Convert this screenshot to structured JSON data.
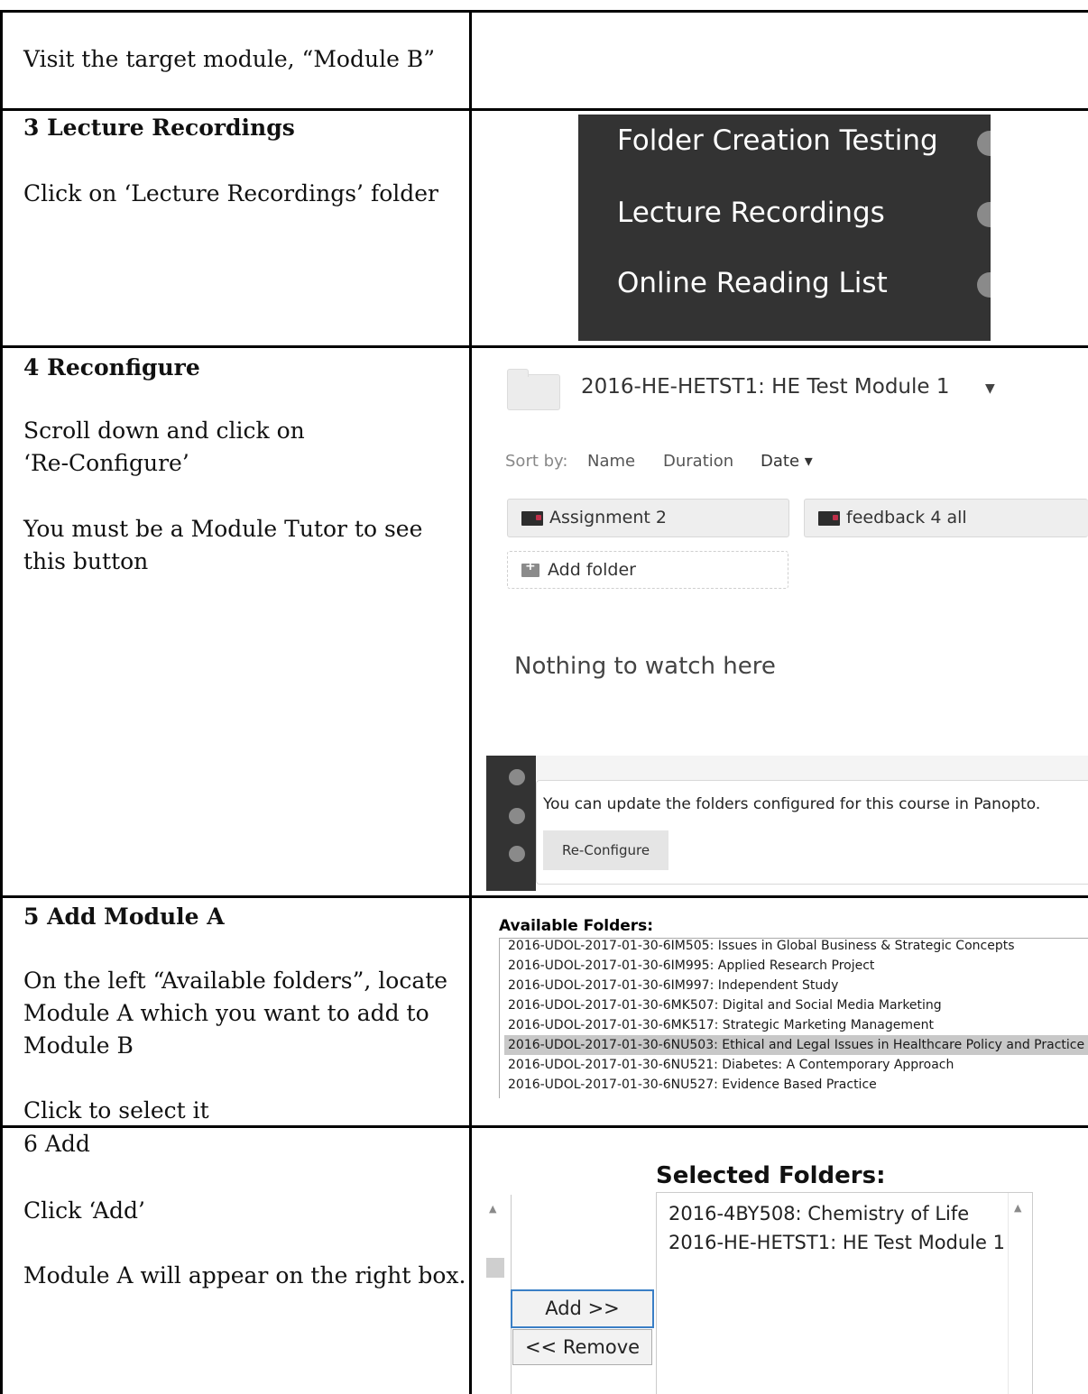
{
  "rows": {
    "r2": {
      "text": "Visit the target module, “Module B”"
    },
    "r3": {
      "heading": "3 Lecture Recordings",
      "text": "Click on ‘Lecture Recordings’ folder"
    },
    "r4": {
      "heading": "4 Reconfigure",
      "text1a": "Scroll down and click on",
      "text1b": "‘Re-Configure’",
      "text2a": "You must be a Module Tutor to see",
      "text2b": "this button"
    },
    "r5": {
      "heading": "5 Add Module A",
      "text1a": "On the left “Available folders”, locate",
      "text1b": "Module A which you want to add to",
      "text1c": "Module B",
      "text2": "Click to select it"
    },
    "r6": {
      "heading": "6  Add",
      "text1": "Click ‘Add’",
      "text2": "Module A will appear on the right box."
    }
  },
  "menu": {
    "items": [
      "Folder Creation Testing",
      "Lecture Recordings",
      "Online Reading List"
    ]
  },
  "panopto": {
    "title": "2016-HE-HETST1: HE Test Module 1",
    "sort_label": "Sort by:",
    "sort_name": "Name",
    "sort_duration": "Duration",
    "sort_date": "Date ▾",
    "folders": [
      "Assignment 2",
      "feedback 4 all"
    ],
    "add_folder": "Add folder",
    "empty": "Nothing to watch here",
    "info": "You can update the folders configured for this course in Panopto.",
    "reconfigure": "Re-Configure"
  },
  "available": {
    "heading": "Available Folders:",
    "items": [
      "2016-UDOL-2017-01-30-6IM505: Issues in Global Business & Strategic Concepts",
      "2016-UDOL-2017-01-30-6IM995: Applied Research Project",
      "2016-UDOL-2017-01-30-6IM997: Independent Study",
      "2016-UDOL-2017-01-30-6MK507: Digital and Social Media Marketing",
      "2016-UDOL-2017-01-30-6MK517: Strategic Marketing Management",
      "2016-UDOL-2017-01-30-6NU503: Ethical and Legal Issues in Healthcare Policy and Practice",
      "2016-UDOL-2017-01-30-6NU521: Diabetes: A Contemporary Approach",
      "2016-UDOL-2017-01-30-6NU527: Evidence Based Practice"
    ]
  },
  "selected": {
    "heading": "Selected Folders:",
    "items": [
      "2016-4BY508: Chemistry of Life",
      "2016-HE-HETST1: HE Test Module 1"
    ],
    "add": "Add >>",
    "remove": "<< Remove"
  }
}
